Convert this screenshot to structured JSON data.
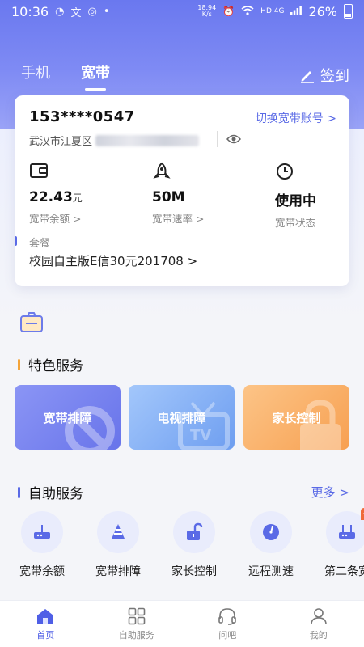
{
  "status_bar": {
    "time": "10:36",
    "net_speed_value": "18.94",
    "net_speed_unit": "K/s",
    "network": "HD 4G",
    "battery": "26%"
  },
  "header": {
    "tabs": [
      {
        "label": "手机",
        "active": false
      },
      {
        "label": "宽带",
        "active": true
      }
    ],
    "sign_in_label": "签到"
  },
  "account": {
    "number": "153****0547",
    "switch_label": "切换宽带账号 >",
    "address_visible": "武汉市江夏区",
    "metrics": [
      {
        "icon": "wallet-icon",
        "value": "22.43",
        "unit": "元",
        "label": "宽带余额 >"
      },
      {
        "icon": "rocket-icon",
        "value": "50M",
        "unit": "",
        "label": "宽带速率 >"
      },
      {
        "icon": "clock-icon",
        "value": "使用中",
        "unit": "",
        "label": "宽带状态"
      }
    ],
    "package_title": "套餐",
    "package_name": "校园自主版E信30元201708  >"
  },
  "featured": {
    "title": "特色服务",
    "tiles": [
      {
        "label": "宽带排障",
        "color": "#7580ee"
      },
      {
        "label": "电视排障",
        "color": "#86b1f6"
      },
      {
        "label": "家长控制",
        "color": "#f9b06b"
      }
    ]
  },
  "self_service": {
    "title": "自助服务",
    "more_label": "更多 >",
    "items": [
      {
        "label": "宽带余额",
        "icon": "router-icon"
      },
      {
        "label": "宽带排障",
        "icon": "repair-icon"
      },
      {
        "label": "家长控制",
        "icon": "lock-icon"
      },
      {
        "label": "远程测速",
        "icon": "speedometer-icon"
      },
      {
        "label": "第二条宽",
        "icon": "router-icon",
        "badge": "优"
      }
    ]
  },
  "bottom_nav": [
    {
      "label": "首页",
      "icon": "home-icon",
      "active": true
    },
    {
      "label": "自助服务",
      "icon": "grid-icon",
      "active": false
    },
    {
      "label": "问吧",
      "icon": "headset-icon",
      "active": false
    },
    {
      "label": "我的",
      "icon": "user-icon",
      "active": false
    }
  ],
  "colors": {
    "accent": "#5a6ae6",
    "header_gradient_top": "#6a78ef",
    "orange_marker": "#f4a43a"
  }
}
